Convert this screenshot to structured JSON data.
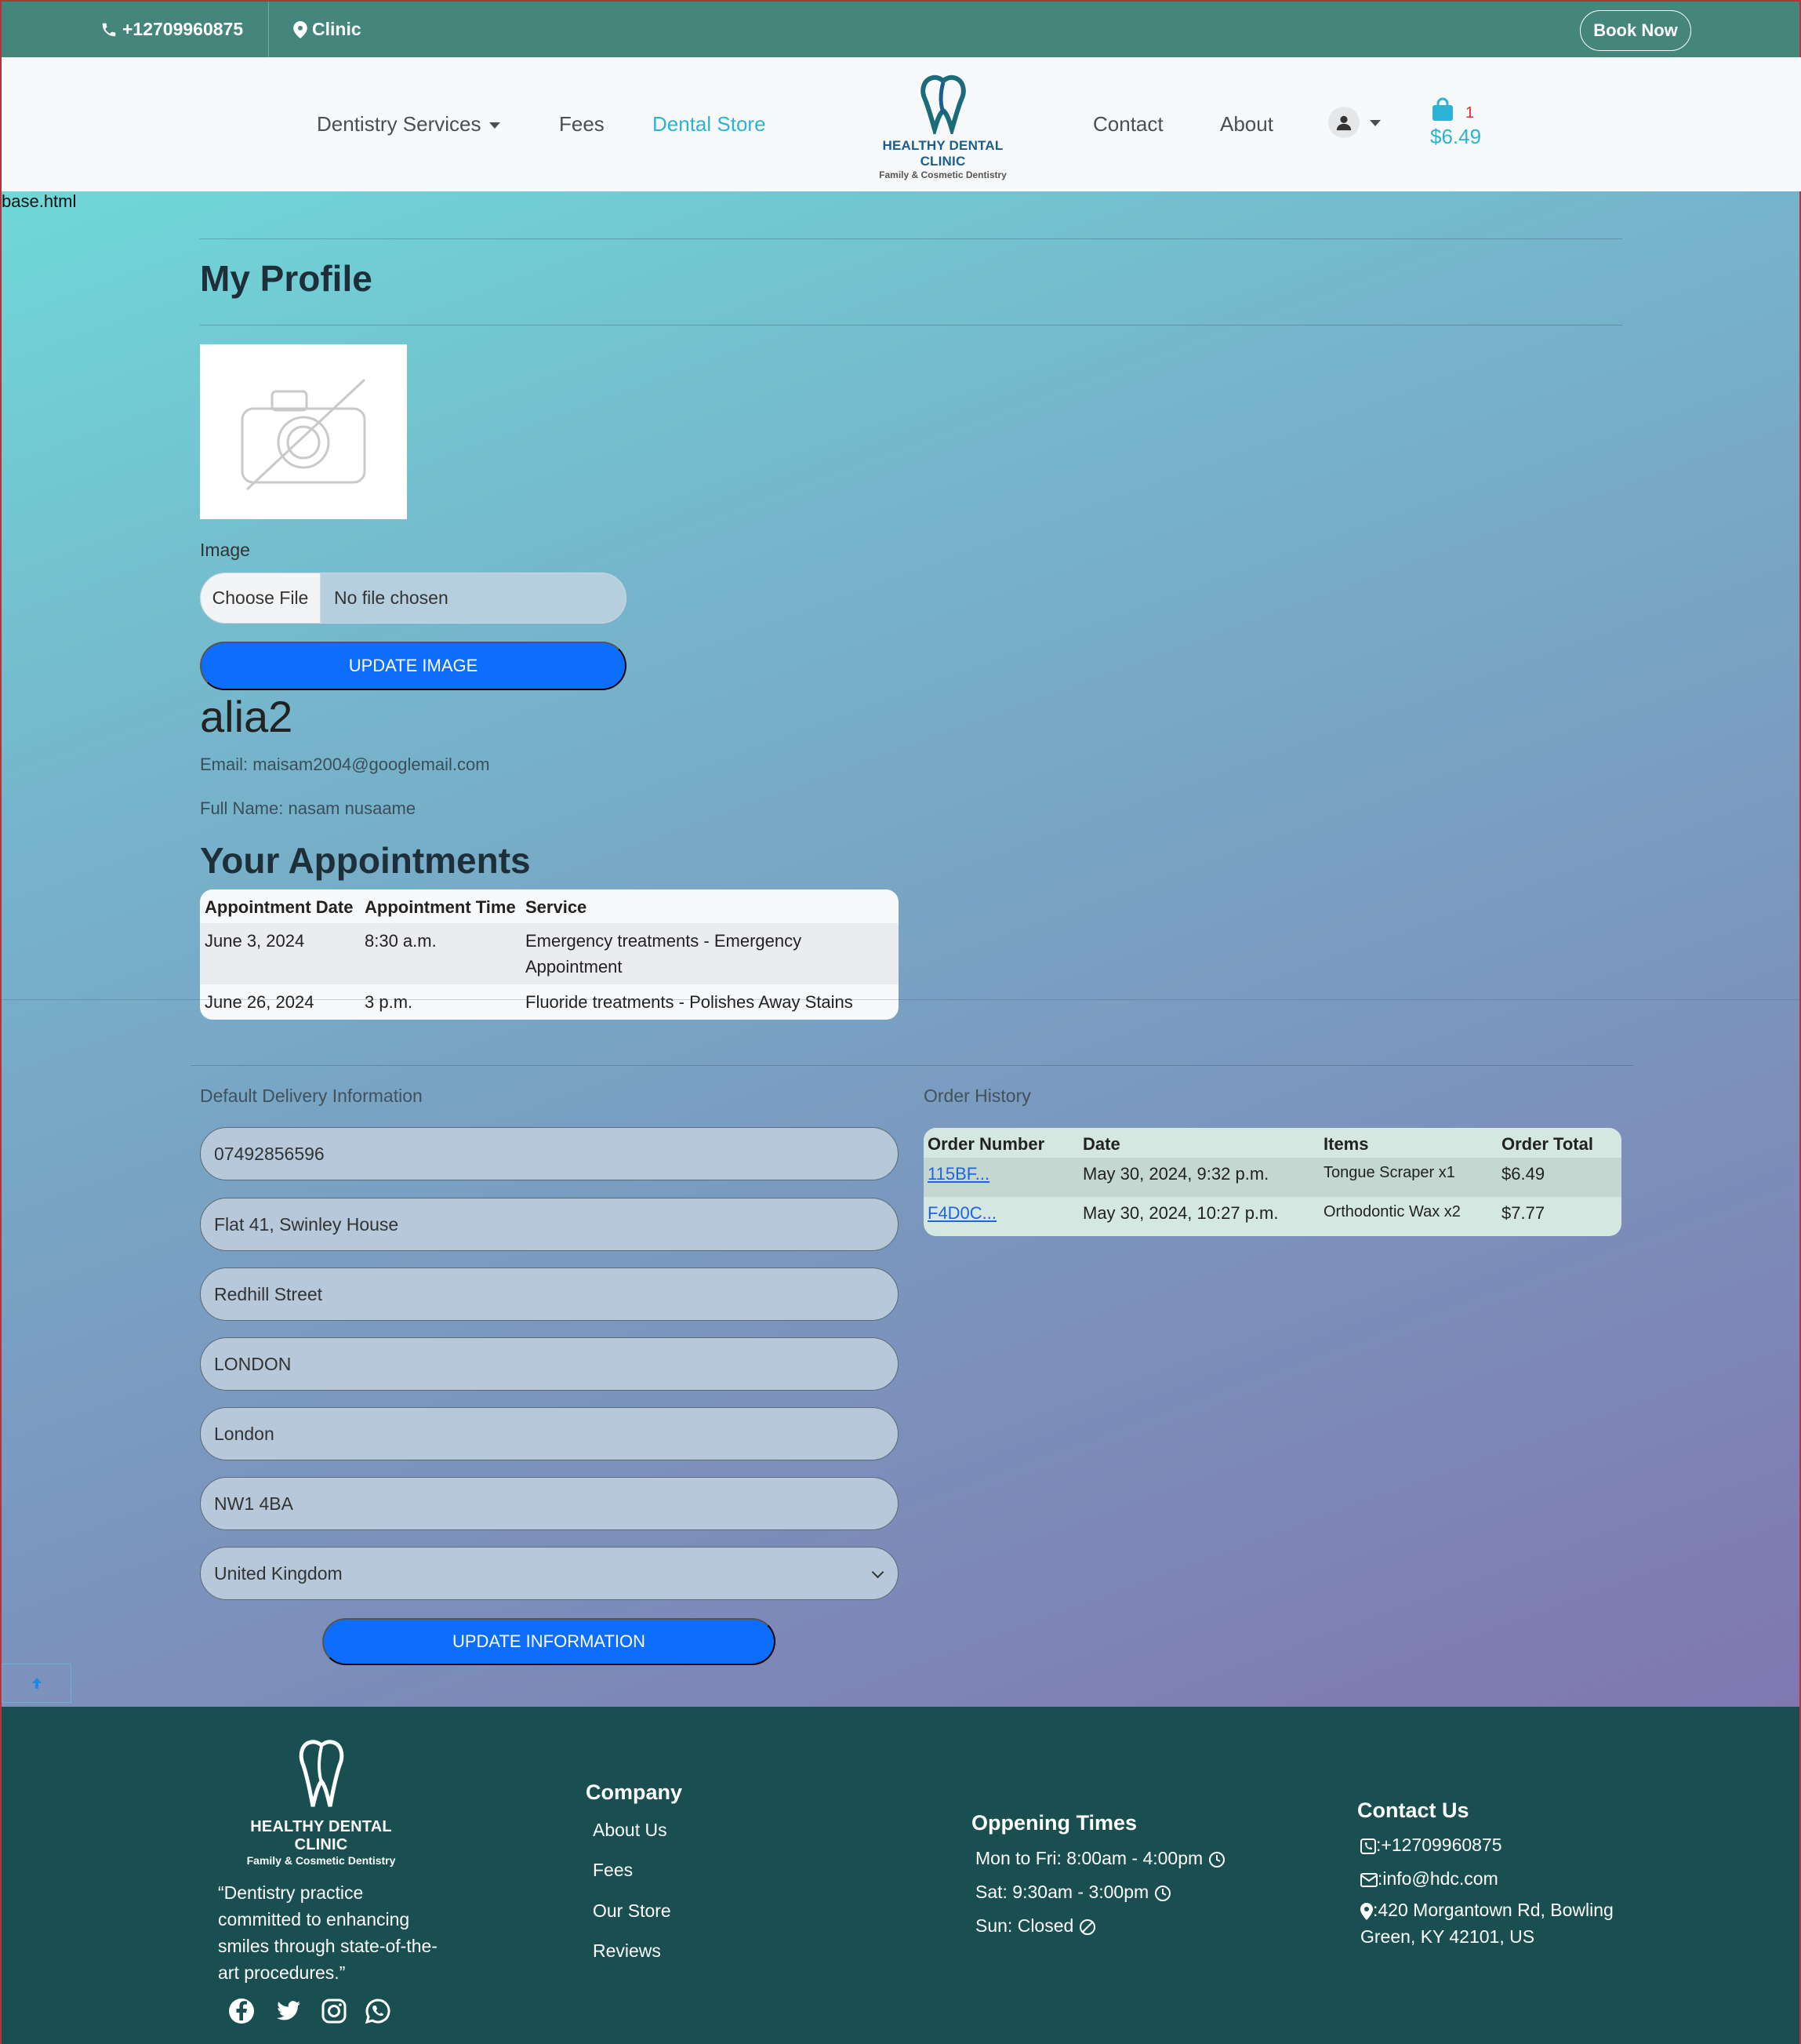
{
  "topbar": {
    "phone": "+12709960875",
    "clinic": "Clinic",
    "book_now": "Book Now"
  },
  "nav": {
    "services": "Dentistry Services",
    "fees": "Fees",
    "store": "Dental Store",
    "contact": "Contact",
    "about": "About",
    "cart_count": "1",
    "cart_total": "$6.49",
    "accent_color": "#2bb3d6"
  },
  "logo": {
    "name": "HEALTHY DENTAL CLINIC",
    "tagline": "Family & Cosmetic Dentistry"
  },
  "page": {
    "base_label": "base.html",
    "title": "My Profile",
    "image_label": "Image",
    "choose_file": "Choose File",
    "no_file": "No file chosen",
    "update_image": "UPDATE IMAGE",
    "username": "alia2",
    "email": "Email: maisam2004@googlemail.com",
    "full_name": "Full Name: nasam nusaame"
  },
  "appointments": {
    "title": "Your Appointments",
    "headers": [
      "Appointment Date",
      "Appointment Time",
      "Service"
    ],
    "rows": [
      [
        "June 3, 2024",
        "8:30 a.m.",
        "Emergency treatments - Emergency Appointment"
      ],
      [
        "June 26, 2024",
        "3 p.m.",
        "Fluoride treatments - Polishes Away Stains"
      ]
    ]
  },
  "delivery": {
    "title": "Default Delivery Information",
    "phone": "07492856596",
    "address1": "Flat 41, Swinley House",
    "address2": "Redhill Street",
    "town": "LONDON",
    "county": "London",
    "postcode": "NW1 4BA",
    "country": "United Kingdom",
    "update_button": "UPDATE INFORMATION"
  },
  "orders": {
    "title": "Order History",
    "headers": [
      "Order Number",
      "Date",
      "Items",
      "Order Total"
    ],
    "rows": [
      [
        "115BF...",
        "May 30, 2024, 9:32 p.m.",
        "Tongue Scraper x1",
        "$6.49"
      ],
      [
        "F4D0C...",
        "May 30, 2024, 10:27 p.m.",
        "Orthodontic Wax x2",
        "$7.77"
      ]
    ]
  },
  "footer": {
    "quote": "“Dentistry practice committed to enhancing smiles through state-of-the-art procedures.”",
    "company_title": "Company",
    "links": [
      "About Us",
      "Fees",
      "Our Store",
      "Reviews"
    ],
    "hours_title": "Oppening Times",
    "hours": [
      "Mon to Fri: 8:00am - 4:00pm",
      "Sat: 9:30am - 3:00pm",
      "Sun: Closed"
    ],
    "contact_title": "Contact Us",
    "contact_phone": ":+12709960875",
    "contact_email": ":info@hdc.com",
    "contact_address": ":420 Morgantown Rd, Bowling Green, KY 42101, US",
    "social": [
      "facebook-icon",
      "twitter-icon",
      "instagram-icon",
      "whatsapp-icon"
    ]
  }
}
